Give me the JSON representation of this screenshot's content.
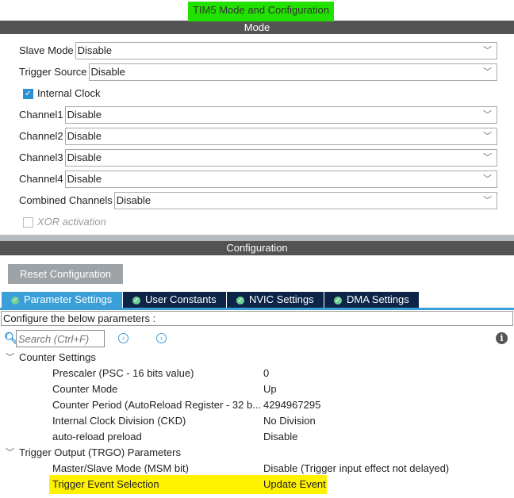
{
  "window_title": "TIM5 Mode and Configuration",
  "mode": {
    "header": "Mode",
    "fields": [
      {
        "label": "Slave Mode",
        "value": "Disable"
      },
      {
        "label": "Trigger Source",
        "value": "Disable"
      }
    ],
    "internal_clock": {
      "label": "Internal Clock",
      "checked": true
    },
    "channels": [
      {
        "label": "Channel1",
        "value": "Disable"
      },
      {
        "label": "Channel2",
        "value": "Disable"
      },
      {
        "label": "Channel3",
        "value": "Disable"
      },
      {
        "label": "Channel4",
        "value": "Disable"
      },
      {
        "label": "Combined Channels",
        "value": "Disable"
      }
    ],
    "xor": {
      "label": "XOR activation",
      "checked": false
    }
  },
  "config": {
    "header": "Configuration",
    "reset_label": "Reset Configuration",
    "tabs": [
      "Parameter Settings",
      "User Constants",
      "NVIC Settings",
      "DMA Settings"
    ],
    "hint": "Configure the below parameters :",
    "search_placeholder": "Search (Ctrl+F)",
    "groups": [
      {
        "name": "Counter Settings",
        "params": [
          {
            "name": "Prescaler (PSC - 16 bits value)",
            "value": "0"
          },
          {
            "name": "Counter Mode",
            "value": "Up"
          },
          {
            "name": "Counter Period (AutoReload Register - 32 b...",
            "value": "4294967295"
          },
          {
            "name": "Internal Clock Division (CKD)",
            "value": "No Division"
          },
          {
            "name": "auto-reload preload",
            "value": "Disable"
          }
        ]
      },
      {
        "name": "Trigger Output (TRGO) Parameters",
        "params": [
          {
            "name": "Master/Slave Mode (MSM bit)",
            "value": "Disable (Trigger input effect not delayed)"
          },
          {
            "name": "Trigger Event Selection",
            "value": "Update Event"
          }
        ]
      }
    ]
  },
  "colors": {
    "title_highlight": "#22e000",
    "row_highlight": "#fff200",
    "tab_active": "#3a9fd8",
    "tab": "#0b2447"
  }
}
